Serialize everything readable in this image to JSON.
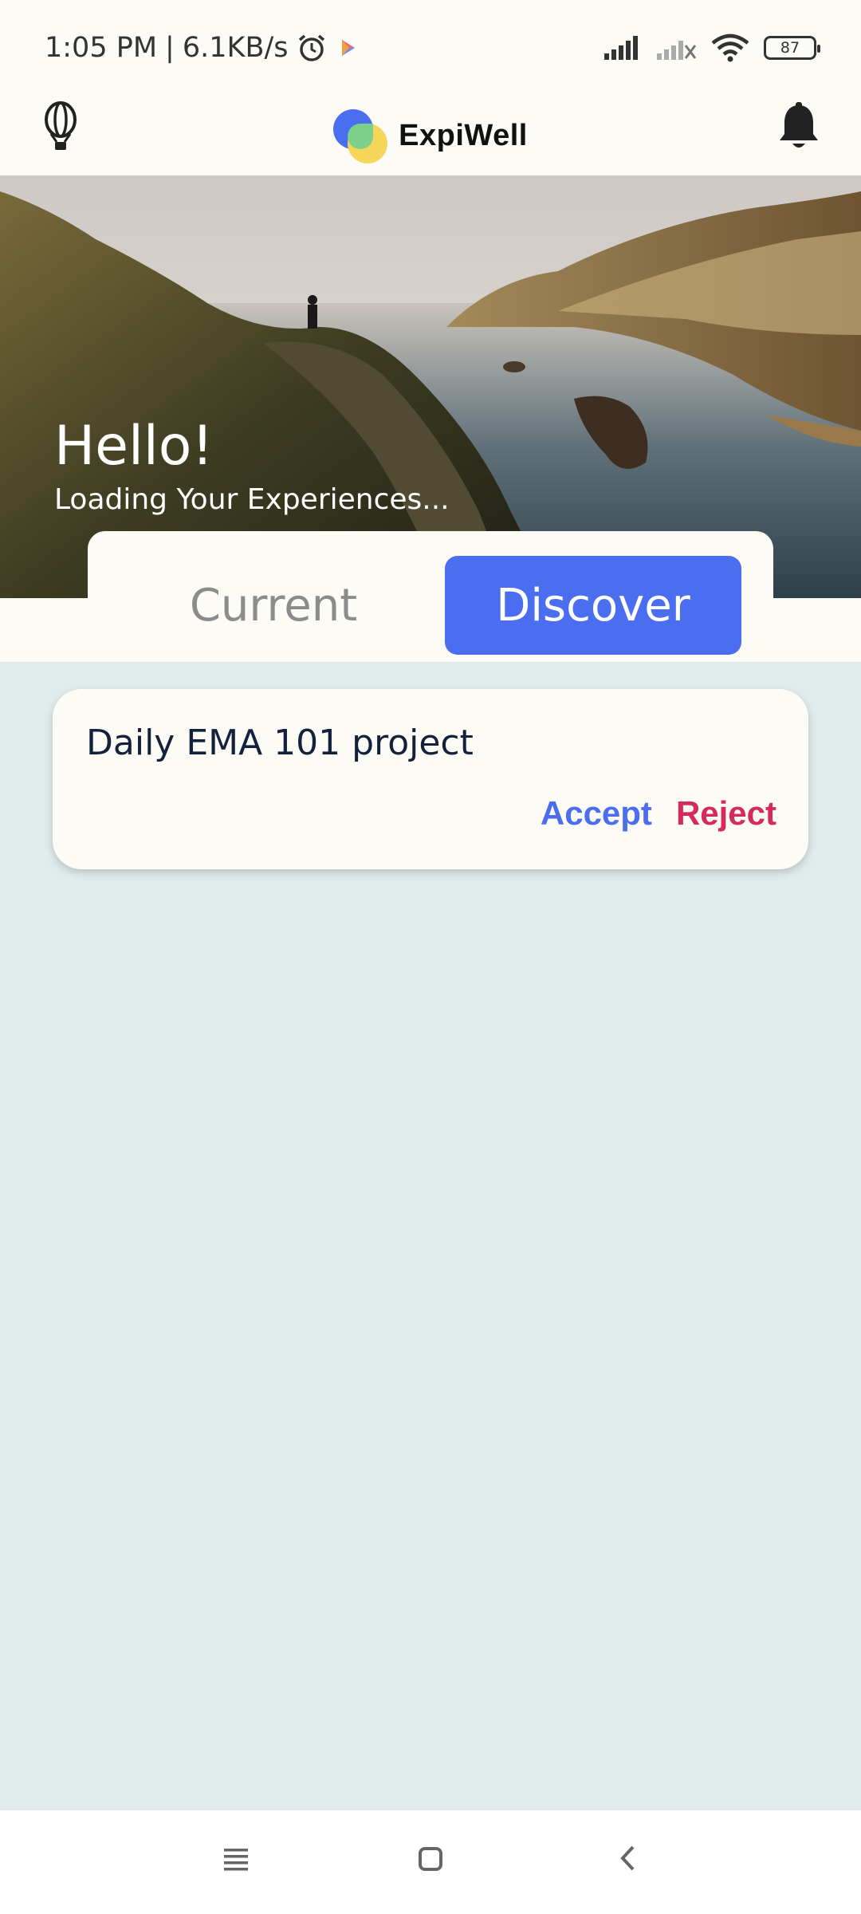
{
  "status_bar": {
    "time": "1:05 PM",
    "separator": "|",
    "network_speed": "6.1KB/s",
    "battery_level": "87",
    "icons": [
      "alarm-icon",
      "play-store-icon",
      "signal-icon",
      "signal-off-icon",
      "wifi-icon",
      "battery-icon"
    ]
  },
  "header": {
    "app_name": "ExpiWell",
    "left_icon": "hot-air-balloon-icon",
    "right_icon": "bell-icon"
  },
  "hero": {
    "title": "Hello!",
    "subtitle": "Loading Your Experiences..."
  },
  "tabs": [
    {
      "label": "Current",
      "active": false
    },
    {
      "label": "Discover",
      "active": true
    }
  ],
  "projects": [
    {
      "title": "Daily EMA 101 project",
      "accept_label": "Accept",
      "reject_label": "Reject"
    }
  ],
  "nav_bar": {
    "icons": [
      "recent-apps-icon",
      "home-icon",
      "back-icon"
    ]
  },
  "colors": {
    "accent": "#4b6ef0",
    "reject": "#d62a5b",
    "surface": "#fdfbf5",
    "background": "#e0ebeb"
  }
}
